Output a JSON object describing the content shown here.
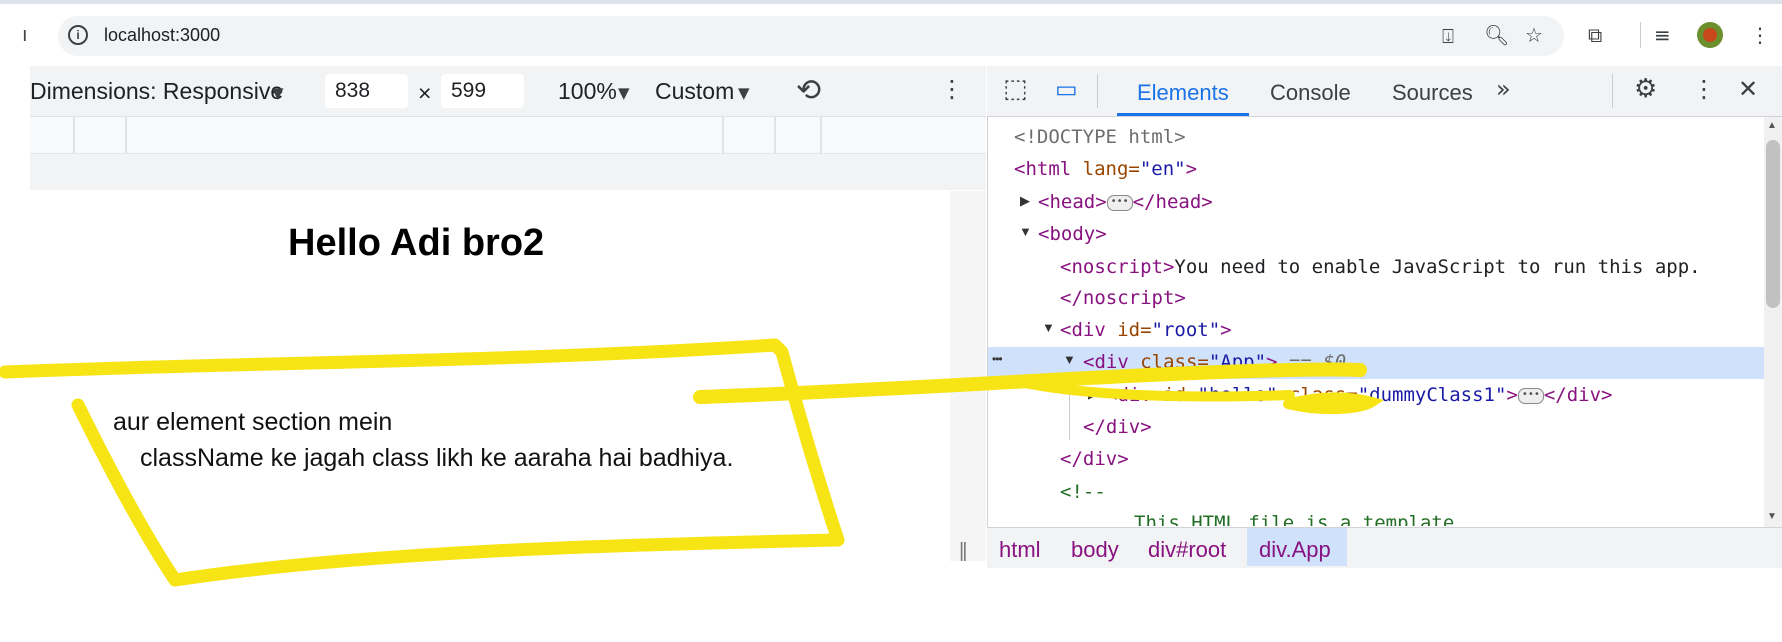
{
  "browser": {
    "url": "localhost:3000",
    "left_edge_glyph": "ı"
  },
  "device_toolbar": {
    "dimensions_label": "Dimensions: Responsive",
    "width_value": "838",
    "times": "×",
    "height_value": "599",
    "zoom": "100%",
    "throttle": "Custom"
  },
  "page": {
    "heading": "Hello Adi bro2",
    "note_line1": "aur element section mein",
    "note_line2": "className ke jagah class likh ke aaraha hai badhiya."
  },
  "devtools": {
    "tabs": [
      "Elements",
      "Console",
      "Sources"
    ],
    "active_tab": "Elements",
    "lines": {
      "doctype": "<!DOCTYPE html>",
      "html_open_tag": "<html",
      "html_attr": " lang=",
      "html_val": "\"en\"",
      "close_gt": ">",
      "head_open": "<head>",
      "head_close": "</head>",
      "body_open": "<body>",
      "noscript_open": "<noscript>",
      "noscript_text": "You need to enable JavaScript to run this app.",
      "noscript_close": "</noscript>",
      "div_open": "<div",
      "root_attr": " id=",
      "root_val": "\"root\"",
      "app_attr": " class=",
      "app_val": "\"App\"",
      "app_marker": " == $0",
      "hello_attr": " id=",
      "hello_val": "\"hello\"",
      "class_attr": " class=",
      "class_val": "\"dummyClass1\"",
      "div_close": "</div>",
      "comment_open": "<!--",
      "comment_text": "This HTML file is a template."
    },
    "breadcrumbs": [
      "html",
      "body",
      "div#root",
      "div.App"
    ],
    "row_dots": "•••"
  },
  "colors": {
    "highlighter": "#f7e414",
    "selection": "#cfe1fb",
    "tag": "#881280",
    "attr": "#994500",
    "value": "#1a1aa6",
    "active_tab": "#1a73e8"
  }
}
